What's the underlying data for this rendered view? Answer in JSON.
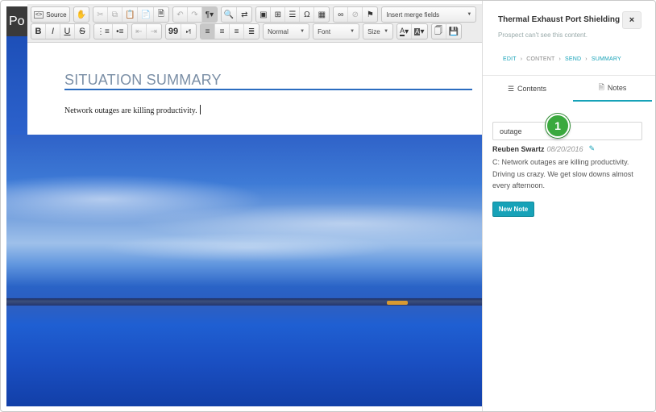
{
  "app": {
    "corner_label": "Po"
  },
  "toolbar": {
    "source_label": "Source",
    "merge_fields_placeholder": "Insert merge fields",
    "format_value": "Normal",
    "font_value": "Font",
    "size_value": "Size",
    "bold_label": "B",
    "italic_label": "I",
    "underline_label": "U",
    "strike_label": "S",
    "quote_label": "99",
    "text_color_label": "A",
    "bg_color_label": "A"
  },
  "document": {
    "heading": "SITUATION SUMMARY",
    "body": "Network outages are killing productivity."
  },
  "panel": {
    "title": "Thermal Exhaust Port Shielding",
    "subtitle": "Prospect can't see this content.",
    "close_label": "×",
    "breadcrumbs": [
      {
        "label": "EDIT",
        "style": "link"
      },
      {
        "label": "CONTENT",
        "style": "plain"
      },
      {
        "label": "SEND",
        "style": "link"
      },
      {
        "label": "SUMMARY",
        "style": "link"
      }
    ],
    "tabs": [
      {
        "label": "Contents",
        "icon": "list-icon"
      },
      {
        "label": "Notes",
        "icon": "document-icon",
        "active": true
      }
    ],
    "search_value": "outage",
    "badge_number": "1",
    "note": {
      "author": "Reuben Swartz",
      "date": "08/20/2016",
      "text": "C: Network outages are killing productivity. Driving us crazy. We get slow downs almost every afternoon."
    },
    "new_note_label": "New Note"
  },
  "colors": {
    "accent": "#17a2b8",
    "badge": "#3aa93e",
    "heading_rule": "#2b6cc0"
  }
}
